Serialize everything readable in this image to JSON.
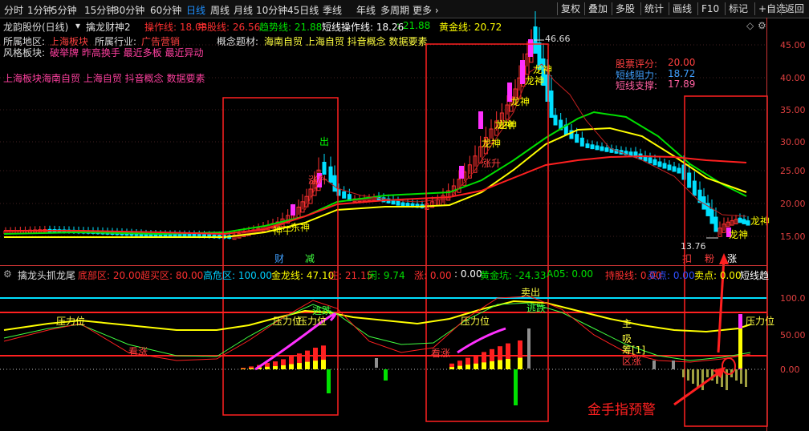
{
  "toolbar": {
    "items": [
      "分时",
      "1分钟",
      "5分钟",
      "15分钟",
      "30分钟",
      "60分钟",
      "日线",
      "周线",
      "月线",
      "10分钟",
      "45日线",
      "季线",
      "年线",
      "多周期",
      "更多 ›"
    ],
    "active_index": 6,
    "right_items": [
      "复权",
      "叠加",
      "多股",
      "统计",
      "画线",
      "F10",
      "标记",
      "+自选",
      "返回"
    ]
  },
  "main": {
    "title": "龙韵股份(日线)",
    "indicator_name": "擒龙财神2",
    "params": [
      {
        "label": "操作线: 18.08",
        "color": "#ff3030"
      },
      {
        "label": "牛股线: 26.56",
        "color": "#ff3030"
      },
      {
        "label": "趋势线: 21.88",
        "color": "#00e000"
      },
      {
        "label": "短线操作线: 18.26",
        "color": "#ffffff"
      },
      {
        "label": ": 21.88",
        "color": "#00e000"
      },
      {
        "label": "黄金线: 20.72",
        "color": "#ffff00"
      }
    ],
    "info1_label": "所属地区:",
    "info1_value": "上海板块",
    "info2_label": "所属行业:",
    "info2_value": "广告营销",
    "concept_label": "概念题材:",
    "concept_value": "海南自贸 上海自贸 抖音概念 数据要素",
    "style_label": "风格板块:",
    "style_value": "破举牌 昨高换手 最近多板 最近异动",
    "board_line": "上海板块海南自贸 上海自贸 抖音概念 数据要素",
    "score_label": "股票评分:",
    "score_value": "20.00",
    "resist_label": "短线阻力:",
    "resist_value": "18.72",
    "support_label": "短线支撑:",
    "support_value": "17.89",
    "high_price": "46.66",
    "low_price": "13.76",
    "y_ticks": [
      "45.00",
      "40.00",
      "35.00",
      "30.00",
      "25.00",
      "20.00",
      "15.00"
    ],
    "tags": [
      "龙神",
      "龙神",
      "龙神",
      "龙神",
      "龙神",
      "龙神",
      "龙神",
      "龙神",
      "涨升",
      "涨升",
      "出",
      "财",
      "减",
      "扣",
      "粉",
      "涨",
      "神牛",
      "东神"
    ]
  },
  "sub": {
    "title": "擒龙头抓龙尾",
    "params": [
      {
        "label": "底部区: 20.00",
        "color": "#ff3030"
      },
      {
        "label": "超买区: 80.00",
        "color": "#ff3030"
      },
      {
        "label": "高危区: 100.00",
        "color": "#00d0ff"
      },
      {
        "label": "金龙线: 47.10",
        "color": "#ffff00"
      },
      {
        "label": "庄: 21.15",
        "color": "#ff3030"
      },
      {
        "label": "闲: 9.74",
        "color": "#00e000"
      },
      {
        "label": "涨: 0.00",
        "color": "#ff3030"
      },
      {
        "label": ": 0.00",
        "color": "#ffffff"
      },
      {
        "label": "黄金坑: -24.33",
        "color": "#00e000"
      },
      {
        "label": "A05: 0.00",
        "color": "#00e000"
      },
      {
        "label": "持股线: 0.00",
        "color": "#ff3030"
      },
      {
        "label": "买点: 0.00",
        "color": "#3050ff"
      },
      {
        "label": "卖点: 0.00",
        "color": "#ffff00"
      },
      {
        "label": "短线趋",
        "color": "#ffffff"
      }
    ],
    "y_ticks": [
      "100.0",
      "50.00",
      "0.00"
    ],
    "labels": {
      "pressure": "压力位",
      "sell": "卖出",
      "escape": "逃跌",
      "rise": "看涨",
      "main": "主",
      "suck": "吸",
      "buy": "筹[1]",
      "zone": "区涨"
    }
  },
  "annotation": "金手指预警",
  "colors": {
    "up": "#ff3030",
    "down": "#00e0ff",
    "red": "#ff2020",
    "yellow": "#ffff00",
    "green": "#00e000",
    "magenta": "#ff30ff",
    "cyan": "#00e0ff"
  }
}
